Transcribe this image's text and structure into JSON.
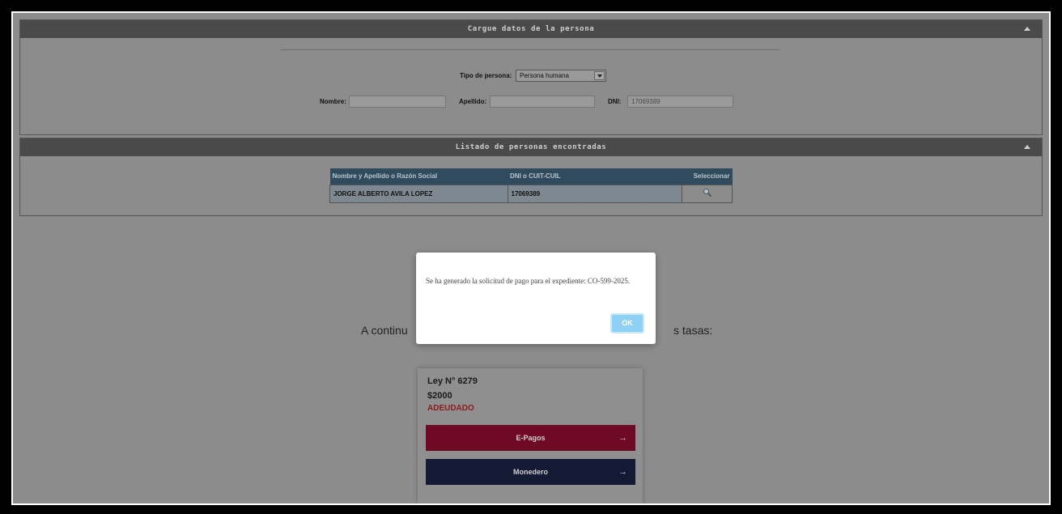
{
  "panel_persona": {
    "title": "Cargue datos de la persona",
    "tipo_label": "Tipo de persona:",
    "tipo_value": "Persona humana",
    "nombre_label": "Nombre:",
    "nombre_value": "",
    "apellido_label": "Apellido:",
    "apellido_value": "",
    "dni_label": "DNI:",
    "dni_value": "17069389"
  },
  "panel_listado": {
    "title": "Listado de personas encontradas",
    "columns": [
      "Nombre y Apellido o Razón Social",
      "DNI o CUIT-CUIL",
      "Seleccionar"
    ],
    "rows": [
      {
        "nombre": "JORGE ALBERTO AVILA LOPEZ",
        "dni": "17069389"
      }
    ]
  },
  "intro": {
    "left_text": "A continu",
    "right_text": "s tasas:"
  },
  "card": {
    "ley": "Ley N° 6279",
    "amount": "$2000",
    "status": "ADEUDADO",
    "epagos_label": "E-Pagos",
    "monedero_label": "Monedero"
  },
  "modal": {
    "message": "Se ha generado la solicitud de pago para el expediente: CO-599-2025.",
    "ok_label": "OK"
  },
  "colors": {
    "header_bg": "#4a4a4a",
    "table_header": "#2f4b5d",
    "epagos": "#6e0a23",
    "monedero": "#141a33",
    "status": "#8e1b1b",
    "ok_button": "#8fd0f5"
  }
}
